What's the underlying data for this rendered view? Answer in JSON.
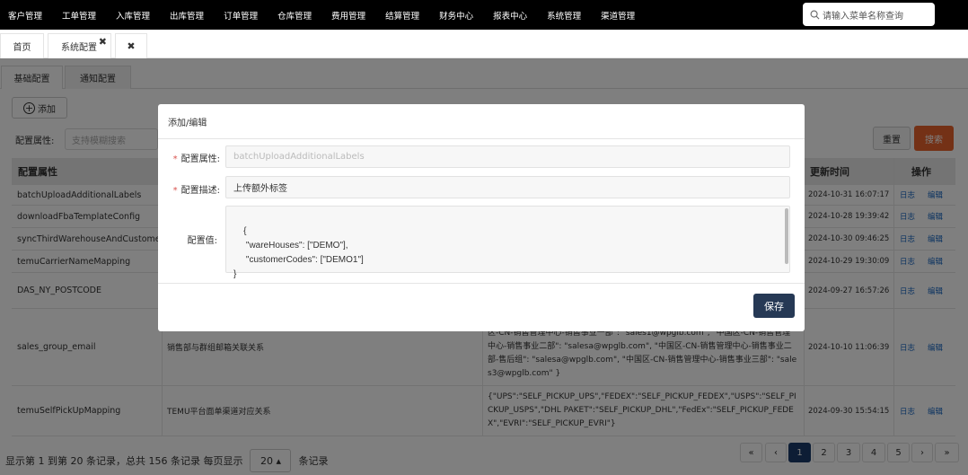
{
  "nav": {
    "items": [
      "客户管理",
      "工单管理",
      "入库管理",
      "出库管理",
      "订单管理",
      "仓库管理",
      "费用管理",
      "结算管理",
      "财务中心",
      "报表中心",
      "系统管理",
      "渠道管理"
    ],
    "search_placeholder": "请输入菜单名称查询"
  },
  "tabs": {
    "home": "首页",
    "config": "系统配置",
    "config_close": "✖",
    "close_all": "✖"
  },
  "subtabs": [
    "基础配置",
    "通知配置"
  ],
  "toolbar": {
    "add_label": "添加",
    "filter_label": "配置属性:",
    "filter_placeholder": "支持模糊搜索",
    "reset_label": "重置",
    "search_label": "搜索"
  },
  "table": {
    "headers": {
      "key": "配置属性",
      "time": "更新时间",
      "ops": "操作"
    },
    "rows": [
      {
        "key": "batchUploadAdditionalLabels",
        "desc": "",
        "value": "",
        "time": "2024-10-31 16:07:17",
        "log": "日志",
        "edit": "编辑"
      },
      {
        "key": "downloadFbaTemplateConfig",
        "desc": "",
        "value": "",
        "time": "2024-10-28 19:39:42",
        "log": "日志",
        "edit": "编辑"
      },
      {
        "key": "syncThirdWarehouseAndCustomer",
        "desc": "",
        "value": "",
        "time": "2024-10-30 09:46:25",
        "log": "日志",
        "edit": "编辑"
      },
      {
        "key": "temuCarrierNameMapping",
        "desc": "",
        "value": "",
        "time": "2024-10-29 19:30:09",
        "log": "日志",
        "edit": "编辑"
      },
      {
        "key": "DAS_NY_POSTCODE",
        "desc": "",
        "value": "",
        "time": "2024-09-27 16:57:26",
        "log": "日志",
        "edit": "编辑"
      },
      {
        "key": "sales_group_email",
        "desc": "销售部与群组邮箱关联关系",
        "value": "区-CN-销售管理中心-销售事业一部\": \"sales1@wpglb.com\", \"中国区-CN-销售管理中心-销售事业二部\": \"salesa@wpglb.com\", \"中国区-CN-销售管理中心-销售事业二部-售后组\": \"salesa@wpglb.com\", \"中国区-CN-销售管理中心-销售事业三部\": \"sales3@wpglb.com\" }",
        "time": "2024-10-10 11:06:39",
        "log": "日志",
        "edit": "编辑"
      },
      {
        "key": "temuSelfPickUpMapping",
        "desc": "TEMU平台面单渠道对应关系",
        "value": "{\"UPS\":\"SELF_PICKUP_UPS\",\"FEDEX\":\"SELF_PICKUP_FEDEX\",\"USPS\":\"SELF_PICKUP_USPS\",\"DHL PAKET\":\"SELF_PICKUP_DHL\",\"FedEx\":\"SELF_PICKUP_FEDEX\",\"EVRI\":\"SELF_PICKUP_EVRI\"}",
        "time": "2024-09-30 15:54:15",
        "log": "日志",
        "edit": "编辑"
      }
    ]
  },
  "footer": {
    "summary": "显示第 1 到第 20 条记录，总共 156 条记录 每页显示",
    "page_size": "20 ▴",
    "suffix": "条记录"
  },
  "pagination": [
    "«",
    "‹",
    "1",
    "2",
    "3",
    "4",
    "5",
    "›",
    "»"
  ],
  "modal": {
    "title": "添加/编辑",
    "required_mark": "*",
    "attr_label": "配置属性:",
    "attr_placeholder": "batchUploadAdditionalLabels",
    "desc_label": "配置描述:",
    "desc_value": "上传额外标签",
    "value_label": "配置值:",
    "value_text": "{\n     \"wareHouses\": [\"DEMO\"],\n     \"customerCodes\": [\"DEMO1\"]\n}",
    "save_label": "保存"
  },
  "colors": {
    "nav_bg": "#000000",
    "search_btn": "#e8622c",
    "save_btn": "#263955",
    "page_active": "#1b3b6a",
    "link": "#1565c0"
  }
}
